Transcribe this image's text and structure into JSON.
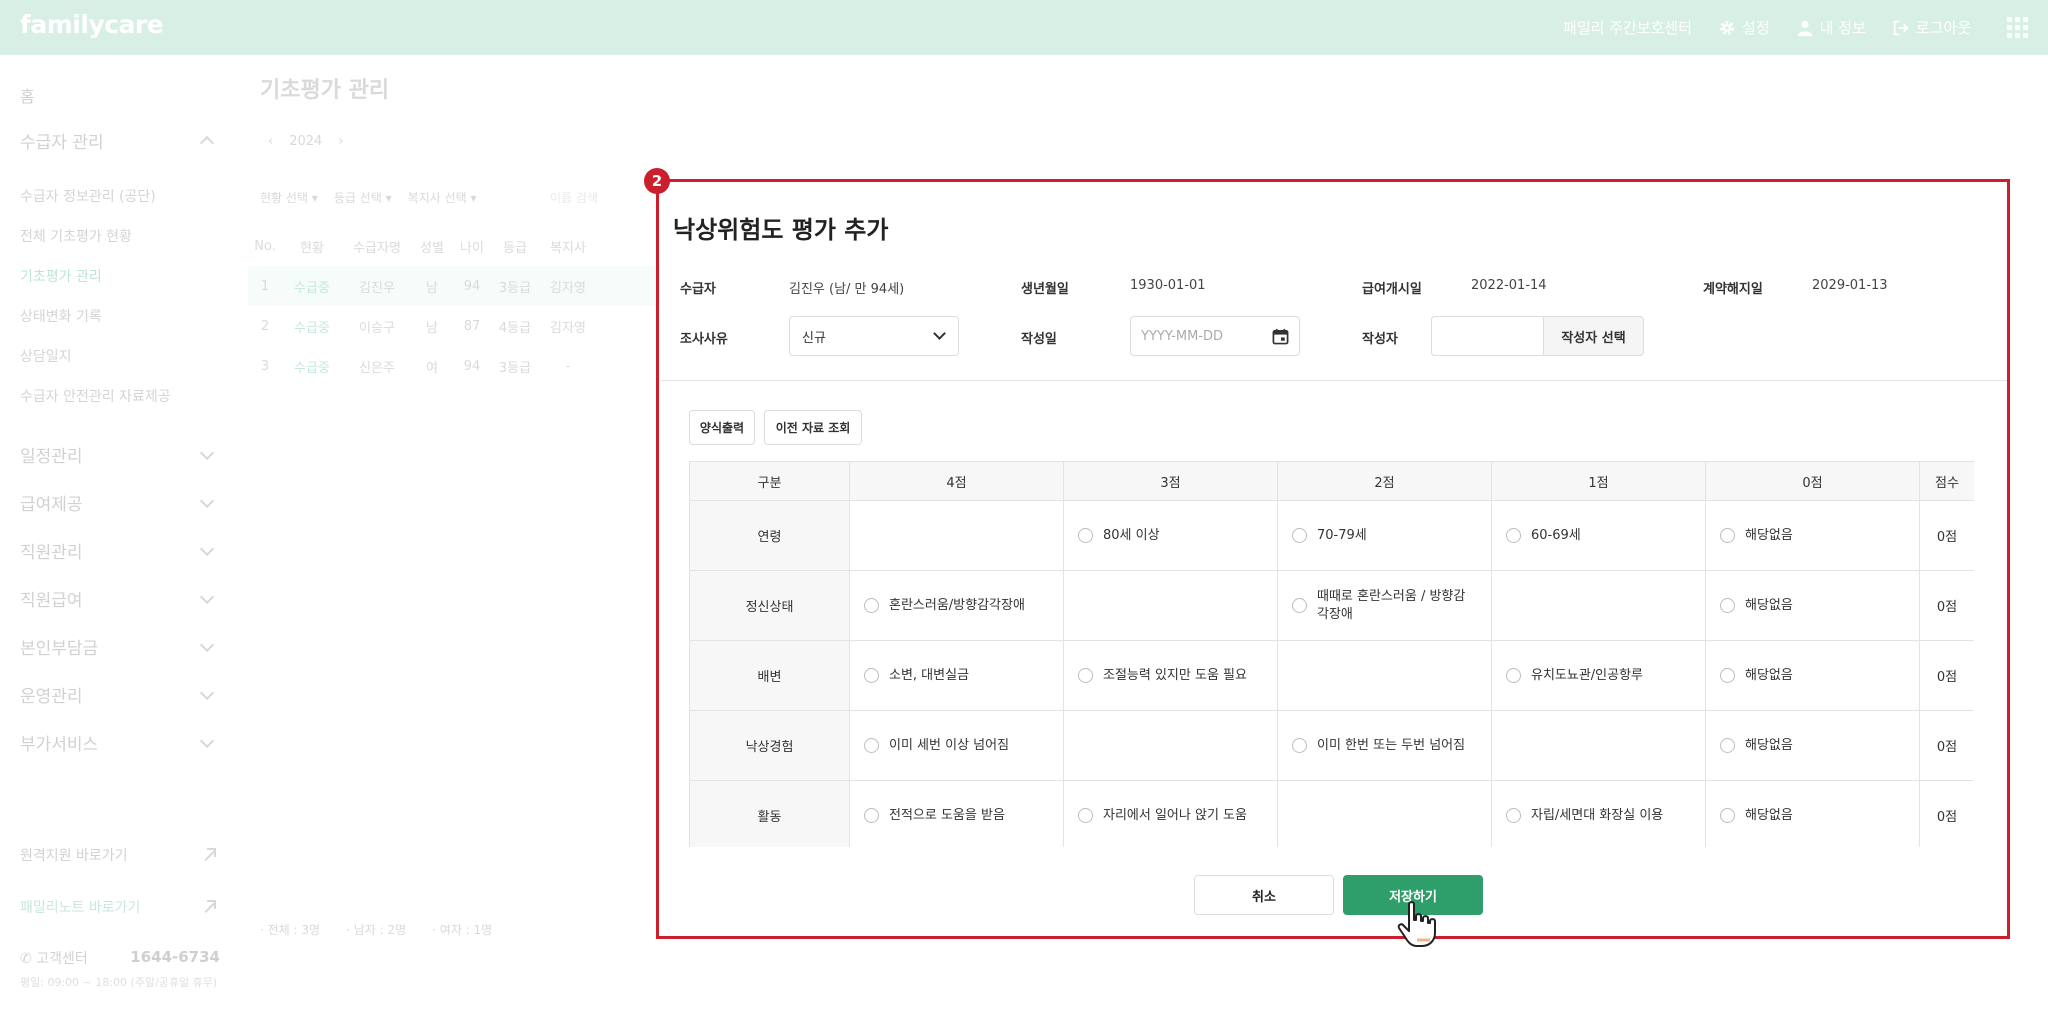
{
  "topbar": {
    "logo": "familycare",
    "center": "패밀리 주간보호센터",
    "settings": "설정",
    "profile": "내 정보",
    "logout": "로그아웃"
  },
  "sidebar": {
    "home": "홈",
    "group_recipient": "수급자 관리",
    "sub_items": [
      "수급자 정보관리 (공단)",
      "전체 기초평가 현황",
      "기초평가 관리",
      "상태변화 기록",
      "상담일지",
      "수급자 안전관리 자료제공"
    ],
    "groups": [
      "일정관리",
      "급여제공",
      "직원관리",
      "직원급여",
      "본인부담금",
      "운영관리",
      "부가서비스"
    ],
    "link_remote": "원격지원 바로가기",
    "link_note": "패밀리노트 바로가기",
    "cs_label": "고객센터",
    "cs_phone": "1644-6734",
    "cs_hours": "평일: 09:00 ~ 18:00 (주말/공휴일 휴무)"
  },
  "background": {
    "page_title": "기초평가 관리",
    "year": "2024",
    "filters": [
      "현황 선택",
      "등급 선택",
      "복지사 선택"
    ],
    "search_placeholder": "이름 검색",
    "columns": [
      "No.",
      "현황",
      "수급자명",
      "성별",
      "나이",
      "등급",
      "복지사"
    ],
    "rows": [
      [
        "1",
        "수급중",
        "김진우",
        "남",
        "94",
        "3등급",
        "김자영"
      ],
      [
        "2",
        "수급중",
        "이승구",
        "남",
        "87",
        "4등급",
        "김자영"
      ],
      [
        "3",
        "수급중",
        "신은주",
        "여",
        "94",
        "3등급",
        "-"
      ]
    ],
    "footer": [
      "전체 : 3명",
      "남자 : 2명",
      "여자 : 1명"
    ]
  },
  "modal": {
    "badge": "2",
    "title": "낙상위험도 평가 추가",
    "recipient_label": "수급자",
    "recipient_value": "김진우 (남/ 만 94세)",
    "birth_label": "생년월일",
    "birth_value": "1930-01-01",
    "start_label": "급여개시일",
    "start_value": "2022-01-14",
    "contract_end_label": "계약해지일",
    "contract_end_value": "2029-01-13",
    "reason_label": "조사사유",
    "reason_value": "신규",
    "date_label": "작성일",
    "date_placeholder": "YYYY-MM-DD",
    "writer_label": "작성자",
    "writer_select": "작성자 선택",
    "print_button": "양식출력",
    "history_button": "이전 자료 조회",
    "table_headers": [
      "구분",
      "4점",
      "3점",
      "2점",
      "1점",
      "0점",
      "점수"
    ],
    "rows": [
      {
        "category": "연령",
        "s4": "",
        "s3": "80세 이상",
        "s2": "70-79세",
        "s1": "60-69세",
        "s0": "해당없음",
        "score": "0점"
      },
      {
        "category": "정신상태",
        "s4": "혼란스러움/방향감각장애",
        "s3": "",
        "s2": "때때로 혼란스러움 / 방향감각장애",
        "s1": "",
        "s0": "해당없음",
        "score": "0점"
      },
      {
        "category": "배변",
        "s4": "소변, 대변실금",
        "s3": "조절능력 있지만 도움 필요",
        "s2": "",
        "s1": "유치도뇨관/인공항루",
        "s0": "해당없음",
        "score": "0점"
      },
      {
        "category": "낙상경험",
        "s4": "이미 세번 이상 넘어짐",
        "s3": "",
        "s2": "이미 한번 또는 두번 넘어짐",
        "s1": "",
        "s0": "해당없음",
        "score": "0점"
      },
      {
        "category": "활동",
        "s4": "전적으로 도움을 받음",
        "s3": "자리에서 일어나 앉기 도움",
        "s2": "",
        "s1": "자립/세면대 화장실 이용",
        "s0": "해당없음",
        "score": "0점"
      }
    ],
    "cancel": "취소",
    "save": "저장하기"
  },
  "colors": {
    "topbar": "#d7efe4",
    "accent": "#2e9e6b",
    "highlight": "#cc1f2d"
  }
}
